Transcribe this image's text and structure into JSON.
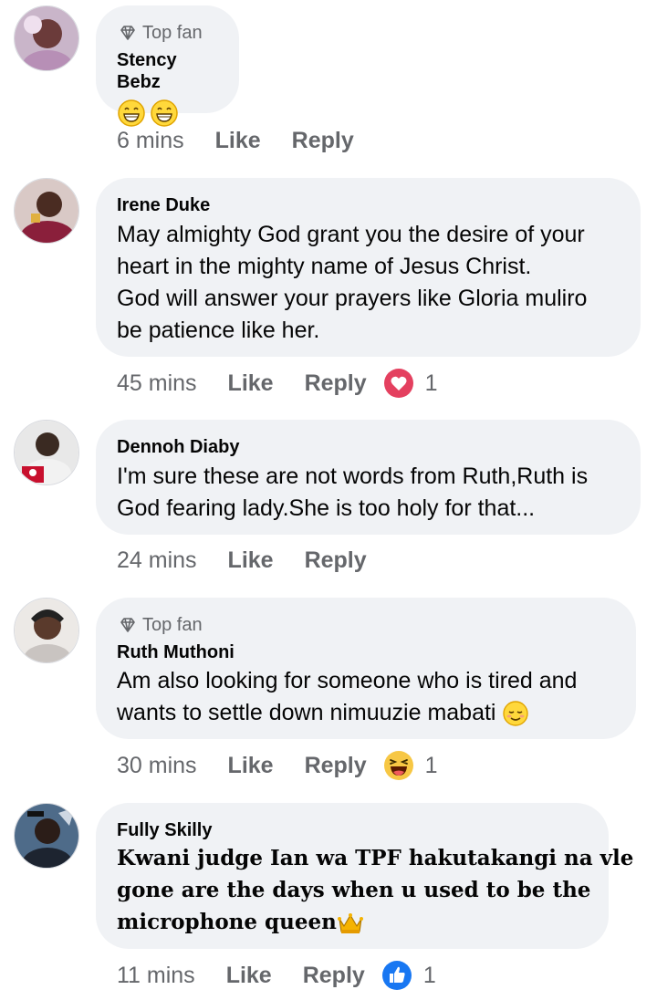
{
  "comments": [
    {
      "author": "Stency Bebz",
      "badge": "Top fan",
      "text_lines": [],
      "emoji": [
        "grin-emoji",
        "grin-emoji"
      ],
      "time": "6 mins",
      "like": "Like",
      "reply": "Reply",
      "reaction": null,
      "reaction_count": ""
    },
    {
      "author": "Irene Duke",
      "badge": "",
      "text_lines": [
        "May almighty God grant you the desire of your",
        "heart in the mighty name of Jesus Christ.",
        "God will answer your prayers like Gloria muliro",
        "be patience like her."
      ],
      "time": "45 mins",
      "like": "Like",
      "reply": "Reply",
      "reaction": "love-icon",
      "reaction_count": "1"
    },
    {
      "author": "Dennoh Diaby",
      "badge": "",
      "text_lines": [
        "I'm sure these are not words from Ruth,Ruth is",
        "God fearing lady.She is too holy for that..."
      ],
      "time": "24 mins",
      "like": "Like",
      "reply": "Reply",
      "reaction": null,
      "reaction_count": ""
    },
    {
      "author": "Ruth Muthoni",
      "badge": "Top fan",
      "text_lines": [
        "Am also looking for someone who is tired and",
        "wants to settle down nimuuzie mabati"
      ],
      "trailing_emoji": "relieved-emoji",
      "time": "30 mins",
      "like": "Like",
      "reply": "Reply",
      "reaction": "haha-icon",
      "reaction_count": "1"
    },
    {
      "author": "Fully Skilly",
      "badge": "",
      "text_lines": [
        "Kwani judge Ian wa TPF hakutakangi na vle",
        "gone are the days when u used to be the",
        "microphone queen"
      ],
      "trailing_emoji": "crown-emoji",
      "time": "11 mins",
      "like": "Like",
      "reply": "Reply",
      "reaction": "like-icon",
      "reaction_count": "1"
    }
  ],
  "colors": {
    "bubble": "#f0f2f5",
    "meta": "#65676b",
    "love": "#e4405f",
    "like": "#1877f2",
    "haha": "#f7c744"
  }
}
